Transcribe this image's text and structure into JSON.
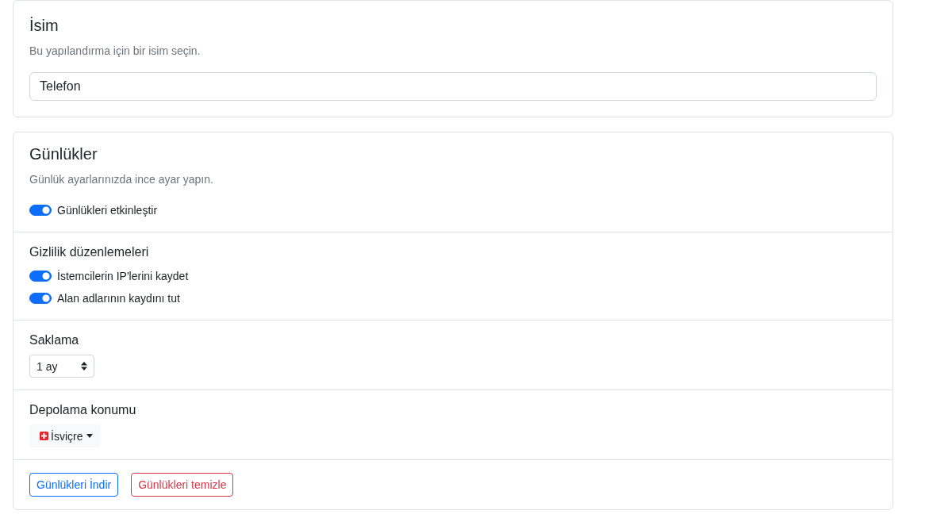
{
  "name_card": {
    "title": "İsim",
    "description": "Bu yapılandırma için bir isim seçin.",
    "input": {
      "value": "Telefon"
    }
  },
  "logs_card": {
    "title": "Günlükler",
    "description": "Günlük ayarlarınızda ince ayar yapın.",
    "switches": [
      {
        "label": "Günlükleri etkinleştir",
        "on": true
      }
    ],
    "sections": [
      {
        "kind": "switches",
        "title": "Gizlilik düzenlemeleri",
        "switches": [
          {
            "label": "İstemcilerin IP'lerini kaydet",
            "on": true
          },
          {
            "label": "Alan adlarının kaydını tut",
            "on": true
          }
        ]
      },
      {
        "kind": "select",
        "title": "Saklama",
        "value": "1 ay"
      },
      {
        "kind": "dropdown",
        "title": "Depolama konumu",
        "value": "İsviçre"
      }
    ],
    "buttons": [
      {
        "label": "Günlükleri İndir",
        "kind": "primary"
      },
      {
        "label": "Günlükleri temizle",
        "kind": "danger"
      }
    ]
  }
}
